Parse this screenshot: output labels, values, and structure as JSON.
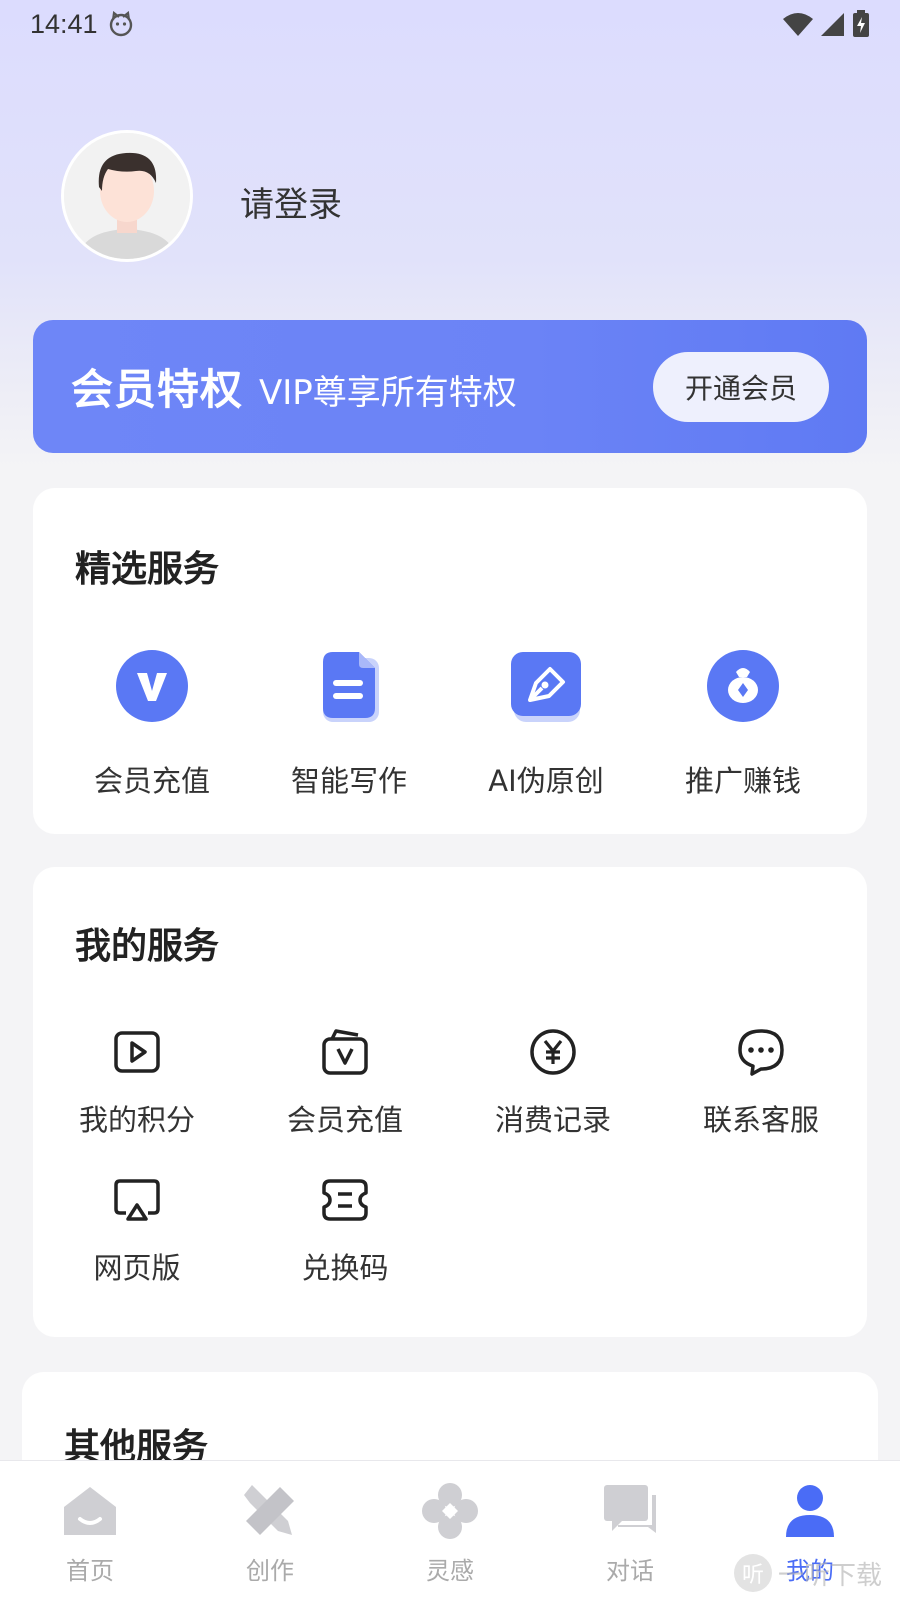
{
  "status_bar": {
    "time": "14:41"
  },
  "profile": {
    "login_prompt": "请登录"
  },
  "vip_banner": {
    "title": "会员特权",
    "subtitle": "VIP尊享所有特权",
    "button_label": "开通会员"
  },
  "featured": {
    "title": "精选服务",
    "items": [
      {
        "label": "会员充值",
        "icon": "vip-v-icon"
      },
      {
        "label": "智能写作",
        "icon": "document-icon"
      },
      {
        "label": "AI伪原创",
        "icon": "pen-nib-icon"
      },
      {
        "label": "推广赚钱",
        "icon": "money-bag-icon"
      }
    ]
  },
  "my_services": {
    "title": "我的服务",
    "items": [
      {
        "label": "我的积分",
        "icon": "play-square-icon"
      },
      {
        "label": "会员充值",
        "icon": "vip-bag-icon"
      },
      {
        "label": "消费记录",
        "icon": "yen-circle-icon"
      },
      {
        "label": "联系客服",
        "icon": "chat-bubble-icon"
      },
      {
        "label": "网页版",
        "icon": "screen-cast-icon"
      },
      {
        "label": "兑换码",
        "icon": "ticket-icon"
      }
    ]
  },
  "other_services": {
    "title": "其他服务"
  },
  "tab_bar": {
    "tabs": [
      {
        "label": "首页",
        "icon": "home-icon",
        "active": false
      },
      {
        "label": "创作",
        "icon": "pen-ruler-icon",
        "active": false
      },
      {
        "label": "灵感",
        "icon": "inspiration-icon",
        "active": false
      },
      {
        "label": "对话",
        "icon": "chat-icon",
        "active": false
      },
      {
        "label": "我的",
        "icon": "user-icon",
        "active": true
      }
    ]
  },
  "watermark": {
    "text": "一听下载",
    "badge": "听"
  },
  "colors": {
    "accent": "#4a6cf6",
    "vip_banner": "#6b83f6",
    "header_bg": "#dcdcfe",
    "page_bg": "#f4f4f6",
    "inactive_tab": "#c8c8cc"
  }
}
